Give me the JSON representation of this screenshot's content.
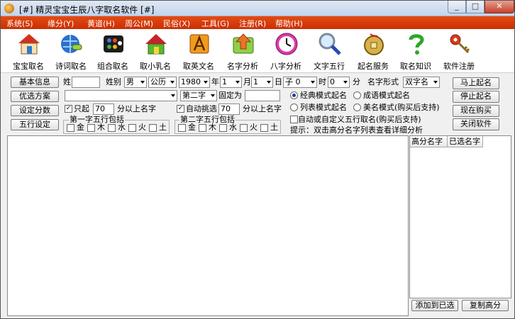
{
  "window": {
    "title": "[#] 精灵宝宝生辰八字取名软件 [#]",
    "min": "_",
    "max": "□",
    "close": "✕"
  },
  "menu": [
    "系统(S)",
    "缘分(Y)",
    "黄道(H)",
    "周公(M)",
    "民俗(X)",
    "工具(G)",
    "注册(R)",
    "帮助(H)"
  ],
  "tools": [
    {
      "label": "宝宝取名",
      "icon": "house-icon"
    },
    {
      "label": "诗词取名",
      "icon": "globe-link-icon"
    },
    {
      "label": "组合取名",
      "icon": "blocks-icon"
    },
    {
      "label": "取小乳名",
      "icon": "home-green-icon"
    },
    {
      "label": "取英文名",
      "icon": "dictionary-icon"
    },
    {
      "label": "名字分析",
      "icon": "arrow-up-icon"
    },
    {
      "label": "八字分析",
      "icon": "clock-icon"
    },
    {
      "label": "文字五行",
      "icon": "magnifier-icon"
    },
    {
      "label": "起名服务",
      "icon": "coin-icon"
    },
    {
      "label": "取名知识",
      "icon": "question-icon"
    },
    {
      "label": "软件注册",
      "icon": "keys-icon"
    }
  ],
  "left_buttons": [
    "基本信息",
    "优选方案",
    "设定分数",
    "五行设定"
  ],
  "form": {
    "surname_label": "姓",
    "surname_value": "",
    "gender_label": "姓别",
    "gender_value": "男",
    "calendar_value": "公历",
    "year_value": "1980",
    "year_label": "年",
    "month_value": "1",
    "month_label": "月",
    "day_value": "1",
    "day_label": "日",
    "hour_value": "子 0",
    "hour_label": "时",
    "minute_value": "0",
    "minute_label": "分",
    "name_form_label": "名字形式",
    "name_form_value": "双字名",
    "plan_value": "",
    "pos_value": "第二字",
    "fixed_label": "固定为",
    "fixed_value": "",
    "only_label": "只起",
    "only_value": "70",
    "only_suffix": "分以上名字",
    "auto_label": "自动挑选",
    "auto_value": "70",
    "auto_suffix": "分以上名字",
    "group1": "第一字五行包括",
    "group2": "第二字五行包括",
    "elements": [
      "金",
      "木",
      "水",
      "火",
      "土"
    ]
  },
  "modes": {
    "classic": "经典模式起名",
    "idiom": "成语模式起名",
    "list": "列表模式起名",
    "beauty": "美名模式(购买后支持)",
    "custom": "自动或自定义五行取名(购买后支持)",
    "hint": "提示：双击高分名字列表查看详细分析"
  },
  "right_buttons": [
    "马上起名",
    "停止起名",
    "现在购买",
    "关闭软件"
  ],
  "tabs": [
    "高分名字",
    "已选名字"
  ],
  "bottom_buttons": [
    "添加到已选",
    "复制高分"
  ],
  "colors": {
    "menu": "#d63a08"
  }
}
